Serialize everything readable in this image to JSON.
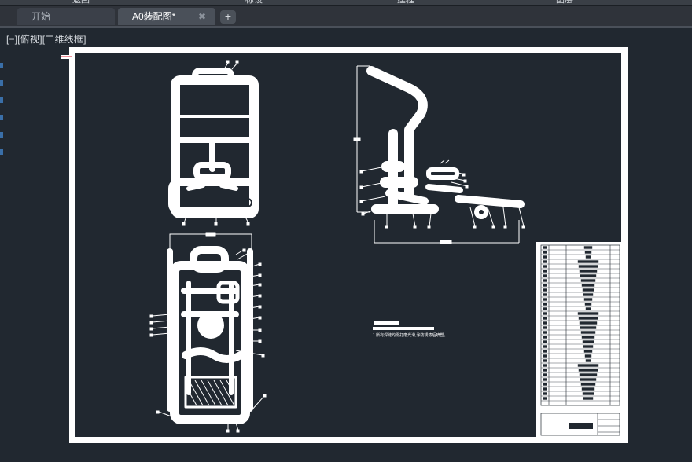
{
  "menubar": {
    "items": [
      "退回",
      "标设",
      "建程",
      "图层"
    ]
  },
  "tabs": [
    {
      "label": "开始",
      "active": false
    },
    {
      "label": "A0装配图*",
      "active": true,
      "close_icon": "close-icon"
    }
  ],
  "add_tab_icon": "plus-icon",
  "viewport_controls": "[−][俯视][二维线框]",
  "drawing": {
    "note": "1.所有焊缝均需打磨光滑,涂防锈漆后喷塑。",
    "colors": {
      "background": "#212830",
      "lines": "#ffffff",
      "viewport_border": "#1530a8"
    }
  }
}
